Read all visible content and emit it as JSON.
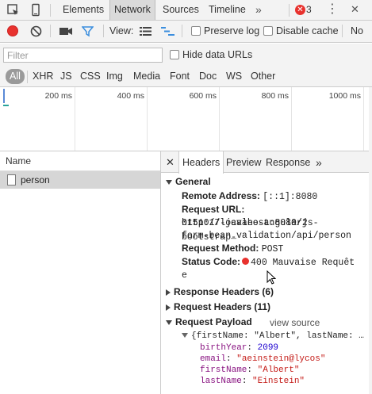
{
  "topbar": {
    "tabs": [
      "Elements",
      "Network",
      "Sources",
      "Timeline"
    ],
    "active_tab": "Network",
    "more": "»",
    "error_count": "3",
    "menu": "⋮",
    "close": "✕"
  },
  "toolbar": {
    "view_label": "View:",
    "preserve_log": "Preserve log",
    "disable_cache": "Disable cache",
    "no_throttle": "No"
  },
  "filter": {
    "placeholder": "Filter",
    "hide_data_urls": "Hide data URLs"
  },
  "type_filters": [
    "All",
    "XHR",
    "JS",
    "CSS",
    "Img",
    "Media",
    "Font",
    "Doc",
    "WS",
    "Other"
  ],
  "overview": {
    "labels": [
      "200 ms",
      "400 ms",
      "600 ms",
      "800 ms",
      "1000 ms"
    ]
  },
  "request_list": {
    "header": "Name",
    "rows": [
      "person"
    ]
  },
  "detail": {
    "close": "✕",
    "tabs": [
      "Headers",
      "Preview",
      "Response"
    ],
    "active_tab": "Headers",
    "more": "»",
    "general": {
      "title": "General",
      "remote_address_label": "Remote Address:",
      "remote_address": "[::1]:8080",
      "request_url_label": "Request URL:",
      "request_url_lines": [
        "http://localhost:8080/2",
        "0151017-javaee-angularjs-bootstrap-",
        "form-bean_validation/api/person"
      ],
      "request_method_label": "Request Method:",
      "request_method": "POST",
      "status_code_label": "Status Code:",
      "status_code_line1": "400 Mauvaise Requêt",
      "status_code_line2": "e"
    },
    "response_headers": "Response Headers (6)",
    "request_headers": "Request Headers (11)",
    "request_payload": {
      "title": "Request Payload",
      "view_source": "view source",
      "summary": "{firstName: \"Albert\", lastName: …",
      "fields": [
        {
          "key": "birthYear",
          "value": "2099",
          "kind": "num"
        },
        {
          "key": "email",
          "value": "\"aeinstein@lycos\"",
          "kind": "str"
        },
        {
          "key": "firstName",
          "value": "\"Albert\"",
          "kind": "str"
        },
        {
          "key": "lastName",
          "value": "\"Einstein\"",
          "kind": "str"
        }
      ]
    }
  },
  "colors": {
    "record": "#e8322e",
    "filter_active": "#3b8ede",
    "json_key": "#881280",
    "json_string": "#c41a16",
    "json_number": "#1c00cf"
  }
}
